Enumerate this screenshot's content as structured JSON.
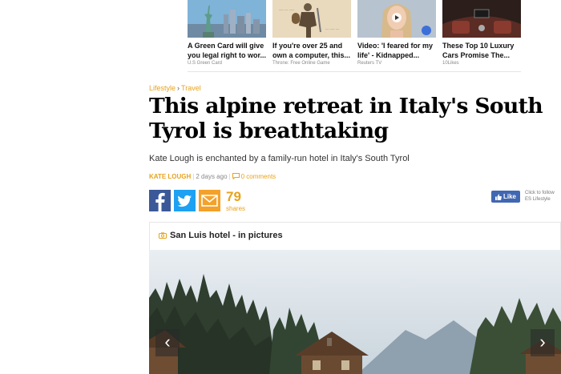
{
  "promos": [
    {
      "title_line1": "A Green Card will give",
      "title_line2": "you legal right to wor...",
      "source": "U.S Green Card",
      "icon": "statue-of-liberty-image"
    },
    {
      "title_line1": "If you're over 25 and",
      "title_line2": "own a computer, this...",
      "source": "Throne: Free Online Game",
      "icon": "warrior-figure-image"
    },
    {
      "title_line1": "Video: 'I feared for my",
      "title_line2": "life' - Kidnapped...",
      "source": "Reuters TV",
      "icon": "woman-portrait-image"
    },
    {
      "title_line1": "These Top 10 Luxury",
      "title_line2": "Cars Promise The...",
      "source": "10Likes",
      "icon": "luxury-car-interior-image"
    }
  ],
  "breadcrumb": {
    "section": "Lifestyle",
    "separator": "›",
    "subsection": "Travel"
  },
  "article": {
    "headline": "This alpine retreat in Italy's South Tyrol is breathtaking",
    "standfirst": "Kate Lough is enchanted by a family-run hotel in Italy's South Tyrol",
    "author": "KATE LOUGH",
    "time_ago": "2 days ago",
    "comments": "0 comments"
  },
  "share": {
    "count": "79",
    "label": "shares",
    "icons": [
      "facebook-icon",
      "twitter-icon",
      "email-icon"
    ]
  },
  "facebook": {
    "like_label": "Like",
    "follow_line1": "Click to follow",
    "follow_line2": "ES Lifestyle"
  },
  "gallery": {
    "title": "San Luis hotel - in pictures",
    "prev_icon": "‹",
    "next_icon": "›"
  },
  "colors": {
    "accent": "#e8a21c",
    "facebook": "#3b5998",
    "twitter": "#1da1f2",
    "email": "#f4a12a",
    "fb_like": "#4267b2"
  }
}
